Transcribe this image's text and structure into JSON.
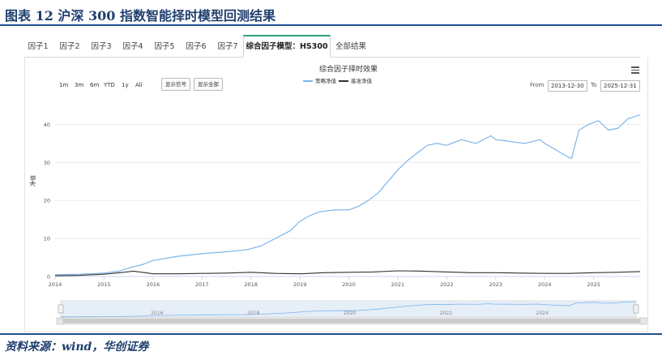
{
  "figure": {
    "title": "图表 12   沪深 300 指数智能择时模型回测结果",
    "source": "资料来源：wind，华创证券"
  },
  "tabs": [
    {
      "label": "因子1"
    },
    {
      "label": "因子2"
    },
    {
      "label": "因子3"
    },
    {
      "label": "因子4"
    },
    {
      "label": "因子5"
    },
    {
      "label": "因子6"
    },
    {
      "label": "因子7"
    },
    {
      "label": "综合因子模型：HS300",
      "active": true
    },
    {
      "label": "全部结果"
    }
  ],
  "toolbar": {
    "range_buttons": [
      "1m",
      "3m",
      "6m",
      "YTD",
      "1y",
      "All"
    ],
    "show_signal": "显示信号",
    "show_all": "显示全部",
    "from_label": "From",
    "from_value": "2013-12-30",
    "to_label": "To",
    "to_value": "2025-12-31",
    "menu_icon": "hamburger-menu-icon"
  },
  "colors": {
    "strategy": "#7cb5ec",
    "benchmark": "#333333",
    "navigator_fill": "#dbe7f5",
    "tab_accent": "#2e9e7c"
  },
  "chart_data": {
    "type": "line",
    "title": "综合因子择时效果",
    "ylabel": "净值",
    "ylim": [
      0,
      45
    ],
    "yticks": [
      0,
      10,
      20,
      30,
      40
    ],
    "xticks": [
      "2014",
      "2015",
      "2016",
      "2017",
      "2018",
      "2019",
      "2020",
      "2021",
      "2022",
      "2023",
      "2024",
      "2025"
    ],
    "navigator_ticks": [
      "2016",
      "2018",
      "2020",
      "2022",
      "2024"
    ],
    "series": [
      {
        "name": "策略净值",
        "color": "#7cb5ec",
        "x": [
          2014.0,
          2014.5,
          2015.0,
          2015.3,
          2015.5,
          2015.8,
          2016.0,
          2016.5,
          2017.0,
          2017.5,
          2017.9,
          2018.2,
          2018.5,
          2018.8,
          2019.0,
          2019.2,
          2019.4,
          2019.7,
          2020.0,
          2020.2,
          2020.4,
          2020.6,
          2020.8,
          2021.0,
          2021.2,
          2021.4,
          2021.6,
          2021.8,
          2022.0,
          2022.3,
          2022.6,
          2022.9,
          2023.0,
          2023.3,
          2023.6,
          2023.9,
          2024.0,
          2024.2,
          2024.4,
          2024.55,
          2024.7,
          2024.9,
          2025.1,
          2025.3,
          2025.5,
          2025.7,
          2025.95
        ],
        "values": [
          0.5,
          0.6,
          0.9,
          1.4,
          2.2,
          3.2,
          4.2,
          5.3,
          6.0,
          6.5,
          7.0,
          8.0,
          10.0,
          12.0,
          14.5,
          16.0,
          17.0,
          17.5,
          17.5,
          18.5,
          20.0,
          22.0,
          25.0,
          28.0,
          30.5,
          32.5,
          34.5,
          35.0,
          34.5,
          36.0,
          35.0,
          37.0,
          36.0,
          35.5,
          35.0,
          36.0,
          35.0,
          33.5,
          32.0,
          31.0,
          38.5,
          40.0,
          41.0,
          38.5,
          39.0,
          41.5,
          42.5
        ]
      },
      {
        "name": "基准净值",
        "color": "#333333",
        "x": [
          2014.0,
          2014.5,
          2015.0,
          2015.4,
          2015.6,
          2015.9,
          2016.0,
          2016.5,
          2017.0,
          2017.5,
          2018.0,
          2018.5,
          2019.0,
          2019.5,
          2020.0,
          2020.5,
          2021.0,
          2021.5,
          2022.0,
          2022.5,
          2023.0,
          2023.5,
          2024.0,
          2024.5,
          2025.0,
          2025.5,
          2025.95
        ],
        "values": [
          0.2,
          0.3,
          0.6,
          1.1,
          1.4,
          0.9,
          0.7,
          0.7,
          0.8,
          0.9,
          1.1,
          0.8,
          0.7,
          1.0,
          1.1,
          1.2,
          1.5,
          1.4,
          1.2,
          1.0,
          1.0,
          0.9,
          0.8,
          0.8,
          1.0,
          1.1,
          1.3
        ]
      }
    ]
  }
}
